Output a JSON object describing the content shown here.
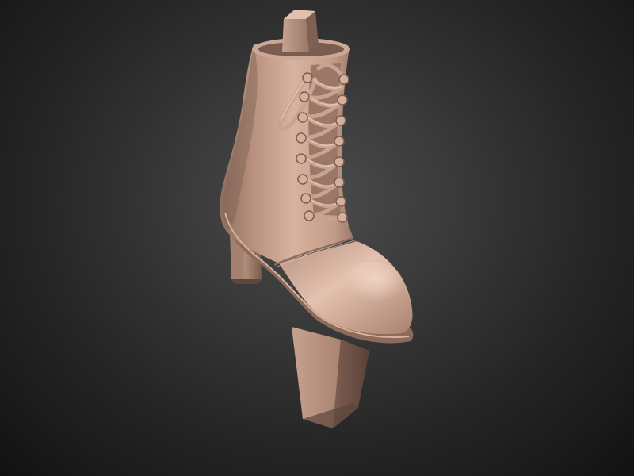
{
  "scene": {
    "subject_icon": "lace-up-high-heel-boot-icon",
    "render_style": "clay sculpt preview",
    "colors": {
      "background_center": "#4c4c4c",
      "background_edge": "#121212",
      "material_light": "#dcb7a3",
      "material_mid": "#b18c7a",
      "material_dark": "#6a5045"
    }
  }
}
